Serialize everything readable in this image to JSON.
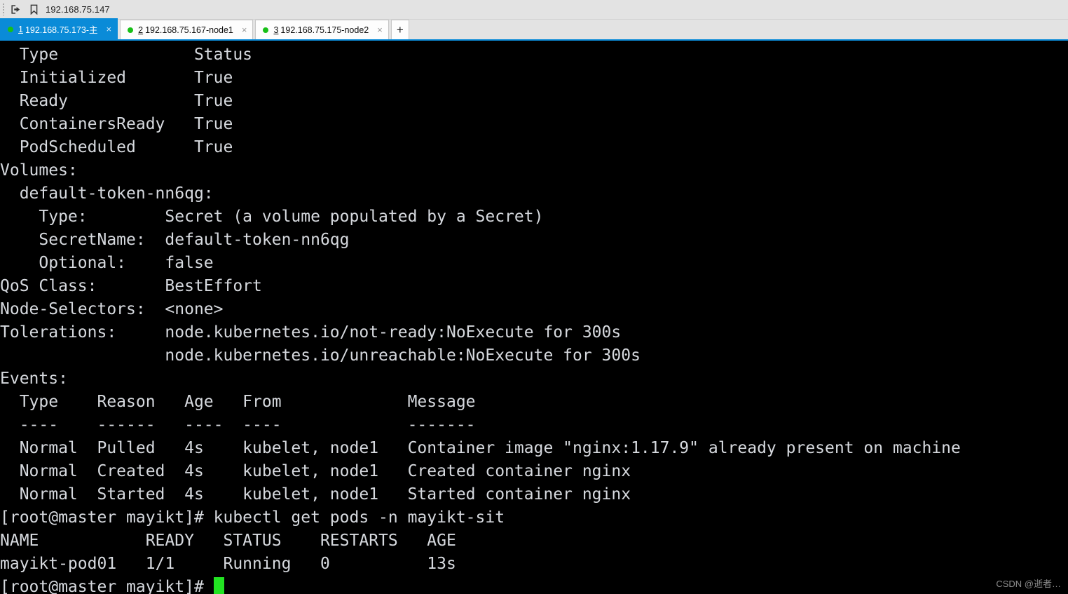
{
  "toolbar": {
    "open_icon": "open-file-icon",
    "bookmark_icon": "bookmark-icon",
    "address": "192.168.75.147"
  },
  "tabs": {
    "add_label": "+",
    "close_label": "×",
    "items": [
      {
        "index": "1",
        "label": "192.168.75.173-主",
        "active": true
      },
      {
        "index": "2",
        "label": "192.168.75.167-node1",
        "active": false
      },
      {
        "index": "3",
        "label": "192.168.75.175-node2",
        "active": false
      }
    ]
  },
  "terminal": {
    "lines": [
      "  Type              Status",
      "  Initialized       True ",
      "  Ready             True ",
      "  ContainersReady   True ",
      "  PodScheduled      True ",
      "Volumes:",
      "  default-token-nn6qg:",
      "    Type:        Secret (a volume populated by a Secret)",
      "    SecretName:  default-token-nn6qg",
      "    Optional:    false",
      "QoS Class:       BestEffort",
      "Node-Selectors:  <none>",
      "Tolerations:     node.kubernetes.io/not-ready:NoExecute for 300s",
      "                 node.kubernetes.io/unreachable:NoExecute for 300s",
      "Events:",
      "  Type    Reason   Age   From             Message",
      "  ----    ------   ----  ----             -------",
      "  Normal  Pulled   4s    kubelet, node1   Container image \"nginx:1.17.9\" already present on machine",
      "  Normal  Created  4s    kubelet, node1   Created container nginx",
      "  Normal  Started  4s    kubelet, node1   Started container nginx",
      "[root@master mayikt]# kubectl get pods -n mayikt-sit",
      "NAME           READY   STATUS    RESTARTS   AGE",
      "mayikt-pod01   1/1     Running   0          13s"
    ],
    "prompt": "[root@master mayikt]# ",
    "cursor": "block-cursor"
  },
  "watermark": "CSDN @逝者…",
  "colors": {
    "accent": "#0a8bd8",
    "terminal_bg": "#000000",
    "terminal_fg": "#d6d9de",
    "cursor": "#22e322",
    "tab_dot": "#18c018"
  }
}
